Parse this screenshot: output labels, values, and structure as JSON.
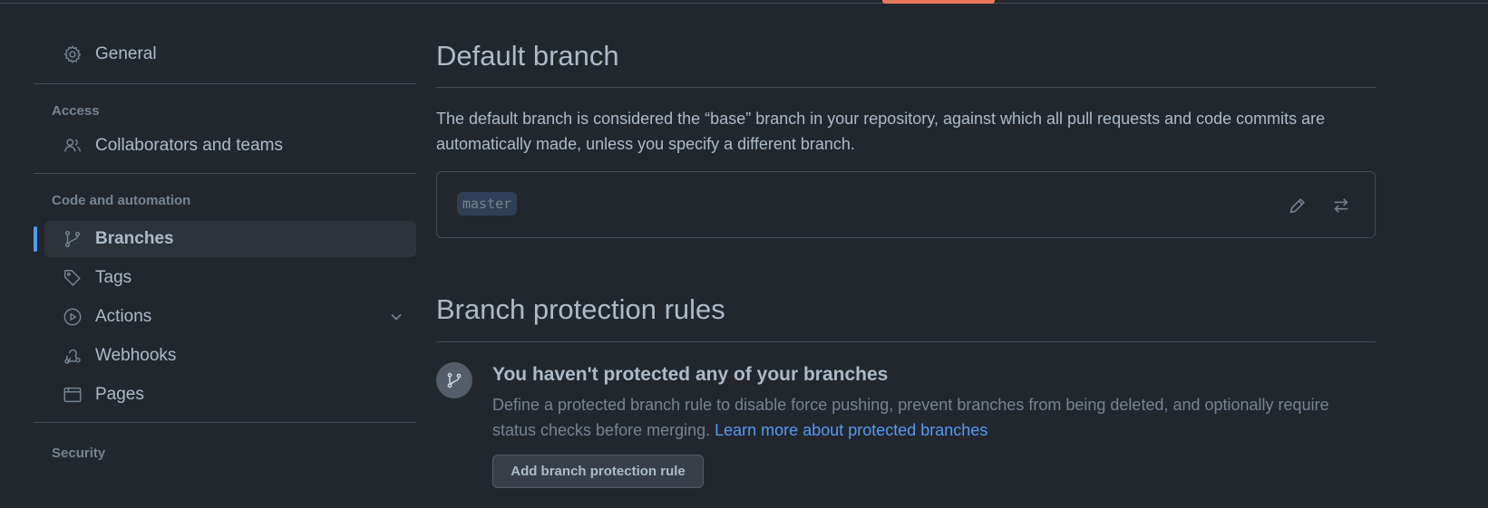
{
  "sidebar": {
    "general": {
      "label": "General",
      "icon": "gear-icon"
    },
    "sections": {
      "access": "Access",
      "code_automation": "Code and automation",
      "security": "Security"
    },
    "items": {
      "collaborators": {
        "label": "Collaborators and teams",
        "icon": "people-icon"
      },
      "branches": {
        "label": "Branches",
        "icon": "git-branch-icon",
        "active": true
      },
      "tags": {
        "label": "Tags",
        "icon": "tag-icon"
      },
      "actions": {
        "label": "Actions",
        "icon": "play-icon",
        "expandable": true
      },
      "webhooks": {
        "label": "Webhooks",
        "icon": "webhook-icon"
      },
      "pages": {
        "label": "Pages",
        "icon": "browser-icon"
      }
    }
  },
  "main": {
    "default_branch": {
      "title": "Default branch",
      "description": "The default branch is considered the “base” branch in your repository, against which all pull requests and code commits are automatically made, unless you specify a different branch.",
      "branch_name": "master",
      "edit_icon": "pencil-icon",
      "switch_icon": "arrow-switch-icon"
    },
    "protection": {
      "title": "Branch protection rules",
      "empty_title": "You haven't protected any of your branches",
      "empty_desc": "Define a protected branch rule to disable force pushing, prevent branches from being deleted, and optionally require status checks before merging.",
      "learn_more": "Learn more about protected branches",
      "add_button": "Add branch protection rule"
    }
  },
  "colors": {
    "background": "#22272e",
    "accent": "#539bf5",
    "tab_underline": "#ec775c",
    "border": "#444c56"
  }
}
